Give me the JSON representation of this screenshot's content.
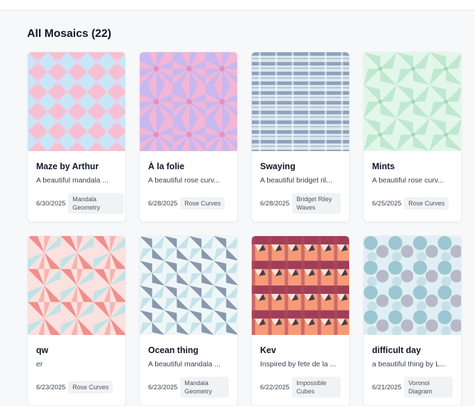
{
  "header": {
    "title": "All Mosaics (22)"
  },
  "colors": {
    "background": "#f7f8fa",
    "card": "#ffffff",
    "tag_bg": "#f1f2f4"
  },
  "cards": [
    {
      "title": "Maze by Arthur",
      "description": "A beautiful mandala ...",
      "date": "6/30/2025",
      "tag": "Mandala Geometry",
      "pattern": "mandala-pastel"
    },
    {
      "title": "À la folie",
      "description": "A beautiful rose curv...",
      "date": "6/28/2025",
      "tag": "Rose Curves",
      "pattern": "rose-pink"
    },
    {
      "title": "Swaying",
      "description": "A beautiful bridget ril...",
      "date": "6/28/2025",
      "tag": "Bridget Riley Waves",
      "pattern": "stripes-blue"
    },
    {
      "title": "Mints",
      "description": "A beautiful rose curv...",
      "date": "6/25/2025",
      "tag": "Rose Curves",
      "pattern": "rose-mint"
    },
    {
      "title": "qw",
      "description": "er",
      "date": "6/23/2025",
      "tag": "Rose Curves",
      "pattern": "rose-coral"
    },
    {
      "title": "Ocean thing",
      "description": "A beautiful mandala ...",
      "date": "6/23/2025",
      "tag": "Mandala Geometry",
      "pattern": "mandala-ocean"
    },
    {
      "title": "Kev",
      "description": "Inspired by fete de la ...",
      "date": "6/22/2025",
      "tag": "Impossible Cubes",
      "pattern": "cubes-red"
    },
    {
      "title": "difficult day",
      "description": "a beautiful thing by L...",
      "date": "6/21/2025",
      "tag": "Voronoi Diagram",
      "pattern": "voronoi-blue"
    }
  ]
}
